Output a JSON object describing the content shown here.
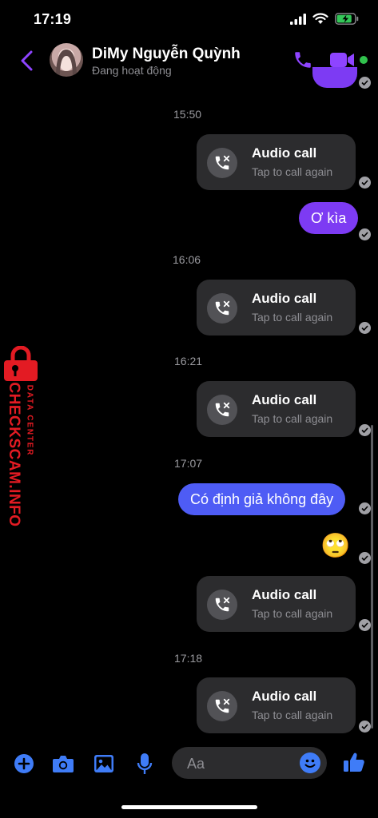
{
  "status_bar": {
    "time": "17:19",
    "battery_level": 0.85
  },
  "header": {
    "contact_name": "DiMy Nguyễn Quỳnh",
    "contact_status": "Đang hoạt động",
    "icons": [
      "back-chevron-icon",
      "phone-icon",
      "video-camera-icon"
    ],
    "accent_color": "#8e44ff",
    "online_color": "#31c24d"
  },
  "messages": [
    {
      "type": "timestamp",
      "text": "15:50"
    },
    {
      "type": "call",
      "title": "Audio call",
      "subtitle": "Tap to call again"
    },
    {
      "type": "text",
      "text": "Ơ kìa",
      "color": "#7d3bf3"
    },
    {
      "type": "timestamp",
      "text": "16:06"
    },
    {
      "type": "call",
      "title": "Audio call",
      "subtitle": "Tap to call again"
    },
    {
      "type": "timestamp",
      "text": "16:21"
    },
    {
      "type": "call",
      "title": "Audio call",
      "subtitle": "Tap to call again"
    },
    {
      "type": "timestamp",
      "text": "17:07"
    },
    {
      "type": "text",
      "text": "Có định giả không đây",
      "color": "#4e5cf5"
    },
    {
      "type": "emoji",
      "text": "🙄"
    },
    {
      "type": "call",
      "title": "Audio call",
      "subtitle": "Tap to call again"
    },
    {
      "type": "timestamp",
      "text": "17:18"
    },
    {
      "type": "call",
      "title": "Audio call",
      "subtitle": "Tap to call again"
    }
  ],
  "watermark": {
    "main": "CHECKSCAM.INFO",
    "sub": "DATA CENTER",
    "color": "#e31b23"
  },
  "composer": {
    "placeholder": "Aa",
    "icons": [
      "plus-icon",
      "camera-icon",
      "image-icon",
      "microphone-icon",
      "emoji-icon",
      "like-icon"
    ],
    "icon_color": "#3f7cf7"
  }
}
